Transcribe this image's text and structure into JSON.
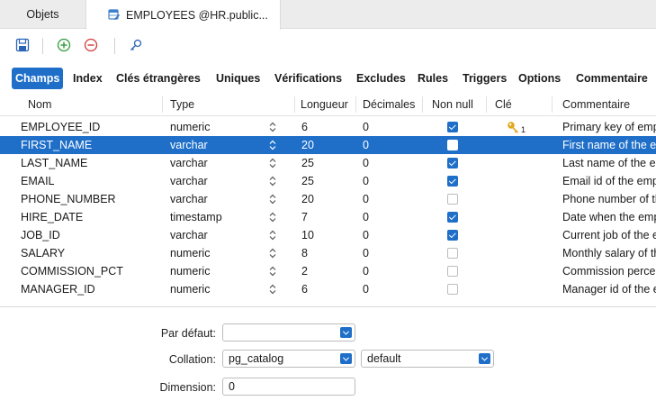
{
  "doc_tabs": [
    {
      "label": "Objets"
    },
    {
      "label": "EMPLOYEES @HR.public..."
    }
  ],
  "toolbar": {
    "icons": [
      "save-icon",
      "add-icon",
      "remove-icon",
      "key-icon"
    ]
  },
  "section_tabs": [
    {
      "label": "Champs",
      "active": true
    },
    {
      "label": "Index"
    },
    {
      "label": "Clés étrangères"
    },
    {
      "label": "Uniques"
    },
    {
      "label": "Vérifications"
    },
    {
      "label": "Excludes"
    },
    {
      "label": "Rules"
    },
    {
      "label": "Triggers"
    },
    {
      "label": "Options"
    },
    {
      "label": "Commentaire"
    }
  ],
  "table": {
    "headers": {
      "name": "Nom",
      "type": "Type",
      "length": "Longueur",
      "decimals": "Décimales",
      "not_null": "Non null",
      "key": "Clé",
      "comment": "Commentaire"
    },
    "rows": [
      {
        "name": "EMPLOYEE_ID",
        "type": "numeric",
        "length": "6",
        "decimals": "0",
        "not_null": true,
        "key": "1",
        "comment": "Primary key of empl"
      },
      {
        "name": "FIRST_NAME",
        "type": "varchar",
        "length": "20",
        "decimals": "0",
        "not_null": false,
        "key": "",
        "comment": "First name of the en",
        "selected": true
      },
      {
        "name": "LAST_NAME",
        "type": "varchar",
        "length": "25",
        "decimals": "0",
        "not_null": true,
        "key": "",
        "comment": "Last name of the em"
      },
      {
        "name": "EMAIL",
        "type": "varchar",
        "length": "25",
        "decimals": "0",
        "not_null": true,
        "key": "",
        "comment": "Email id of the empl"
      },
      {
        "name": "PHONE_NUMBER",
        "type": "varchar",
        "length": "20",
        "decimals": "0",
        "not_null": false,
        "key": "",
        "comment": "Phone number of th"
      },
      {
        "name": "HIRE_DATE",
        "type": "timestamp",
        "length": "7",
        "decimals": "0",
        "not_null": true,
        "key": "",
        "comment": "Date when the empl"
      },
      {
        "name": "JOB_ID",
        "type": "varchar",
        "length": "10",
        "decimals": "0",
        "not_null": true,
        "key": "",
        "comment": "Current job of the e"
      },
      {
        "name": "SALARY",
        "type": "numeric",
        "length": "8",
        "decimals": "0",
        "not_null": false,
        "key": "",
        "comment": "Monthly salary of th"
      },
      {
        "name": "COMMISSION_PCT",
        "type": "numeric",
        "length": "2",
        "decimals": "0",
        "not_null": false,
        "key": "",
        "comment": "Commission percen"
      },
      {
        "name": "MANAGER_ID",
        "type": "numeric",
        "length": "6",
        "decimals": "0",
        "not_null": false,
        "key": "",
        "comment": "Manager id of the e"
      }
    ]
  },
  "panel": {
    "default_label": "Par défaut:",
    "default_value": "",
    "collation_label": "Collation:",
    "collation_schema": "pg_catalog",
    "collation_value": "default",
    "dimension_label": "Dimension:",
    "dimension_value": "0"
  },
  "colors": {
    "accent": "#1f6fc9",
    "key_icon": "#e0a81c",
    "add_icon": "#2e9b3a",
    "remove_icon": "#d43a3a"
  }
}
